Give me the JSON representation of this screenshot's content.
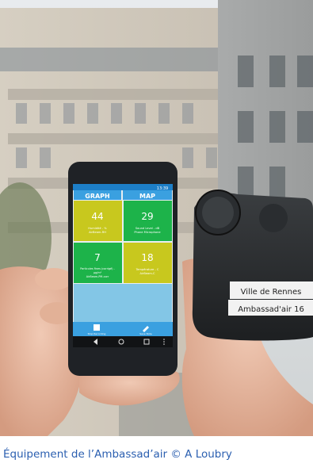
{
  "photo": {
    "subject": "smartphone-and-sensor",
    "phone": {
      "status_bar": {
        "time": "13:39"
      },
      "tabs": [
        {
          "label": "GRAPH",
          "color": "#3aa0e0"
        },
        {
          "label": "MAP",
          "color": "#3aa0e0"
        }
      ],
      "tiles": [
        {
          "value": "44",
          "line1": "Humidité - %",
          "line2": "AirBeam-RH",
          "color": "#c8c81e"
        },
        {
          "value": "29",
          "line1": "Sound Level - dB",
          "line2": "Phone Microphone",
          "color": "#1db34a"
        },
        {
          "value": "7",
          "line1": "Particules fines (corrigé) -",
          "line2": "µg/m³",
          "line3": "AirBeam-PM-corr",
          "color": "#1db34a"
        },
        {
          "value": "18",
          "line1": "Température - C",
          "line2": "AirBeam-C",
          "color": "#c8c81e"
        }
      ],
      "bottom_actions": [
        {
          "label": "Stop Recording",
          "icon": "stop-icon"
        },
        {
          "label": "Save Note",
          "icon": "pencil-icon"
        }
      ],
      "nav_icons": [
        "back-icon",
        "home-icon",
        "recents-icon",
        "menu-icon"
      ]
    },
    "sensor_labels": [
      "Ville de Rennes",
      "Ambassad'air 16"
    ]
  },
  "caption": "Équipement de l’Ambassad’air © A Loubry"
}
